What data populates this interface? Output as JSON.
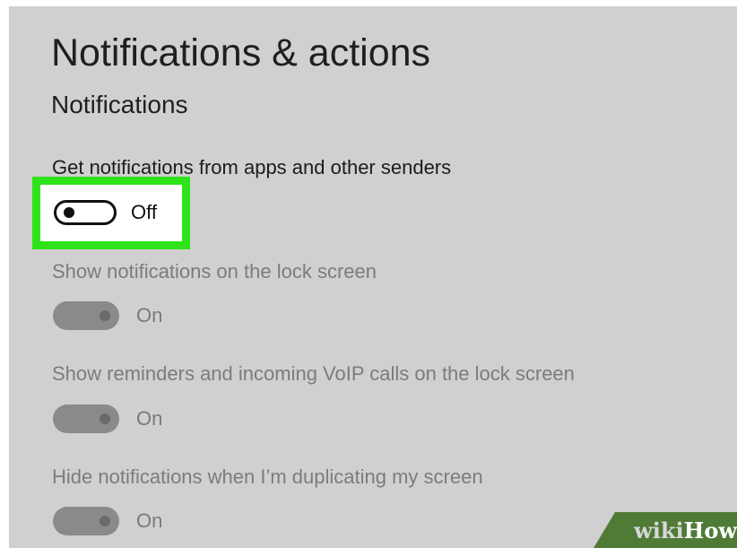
{
  "page": {
    "title": "Notifications & actions",
    "section_title": "Notifications"
  },
  "settings": [
    {
      "label": "Get notifications from apps and other senders",
      "state": "Off",
      "enabled": true,
      "highlighted": true
    },
    {
      "label": "Show notifications on the lock screen",
      "state": "On",
      "enabled": false
    },
    {
      "label": "Show reminders and incoming VoIP calls on the lock screen",
      "state": "On",
      "enabled": false
    },
    {
      "label": "Hide notifications when I’m duplicating my screen",
      "state": "On",
      "enabled": false
    }
  ],
  "watermark": {
    "part1": "wiki",
    "part2": "How"
  },
  "colors": {
    "background": "#d0d0d0",
    "highlight": "#2fe31b",
    "toggle_on_disabled": "#8a8a8a",
    "watermark": "#4f7b36"
  }
}
